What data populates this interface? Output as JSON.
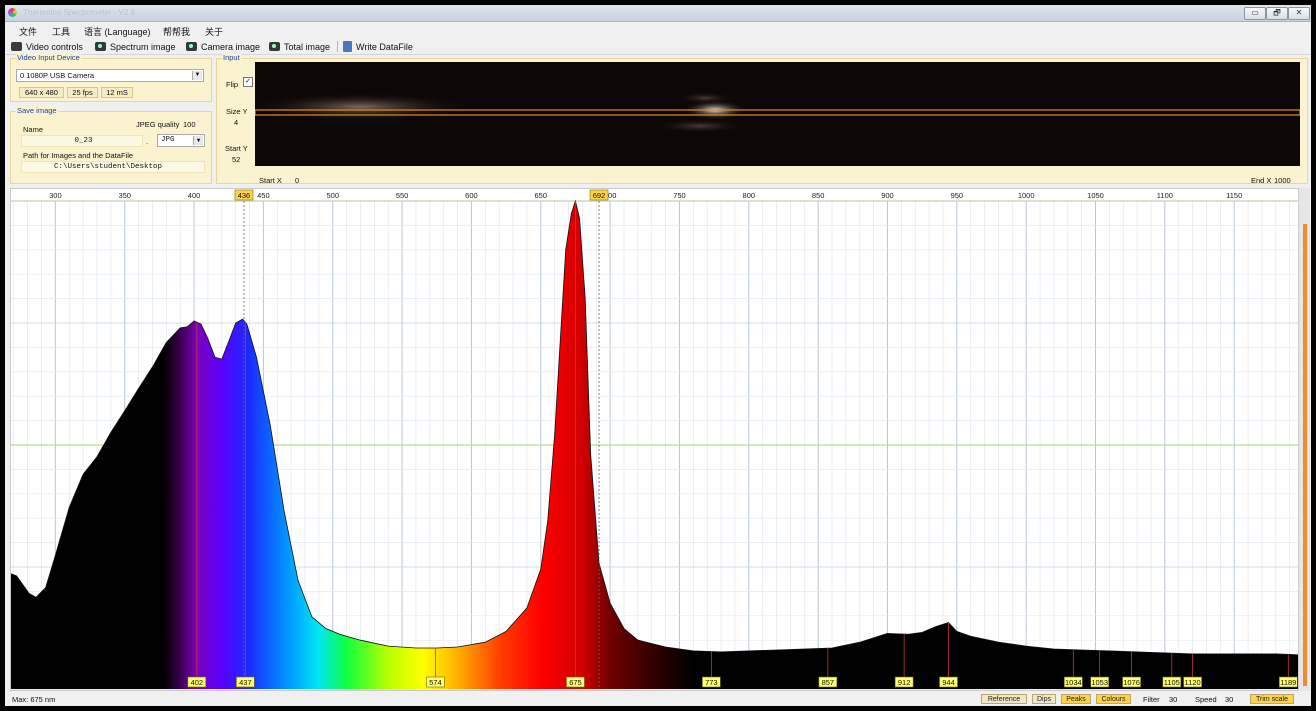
{
  "window": {
    "title": "Theremino Spectrometer - V2.8",
    "buttons": [
      "▭",
      "🗗",
      "✕"
    ]
  },
  "menu": [
    "文件",
    "工具",
    "语言 (Language)",
    "帮帮我",
    "关于"
  ],
  "toolbar": [
    {
      "label": "Video controls",
      "icon": "video-camera-icon"
    },
    {
      "label": "Spectrum image",
      "icon": "photo-camera-icon"
    },
    {
      "label": "Camera image",
      "icon": "photo-camera-icon"
    },
    {
      "label": "Total image",
      "icon": "photo-camera-icon"
    },
    {
      "label": "Write DataFile",
      "icon": "file-icon"
    }
  ],
  "video_input": {
    "title": "Video Input Device",
    "device": "0 1080P USB Camera",
    "resolution": "640 x 480",
    "fps": "25 fps",
    "latency": "12 mS"
  },
  "save_image": {
    "title": "Save image",
    "name_label": "Name",
    "name_value": "0_23",
    "dot": ".",
    "jpeg_quality_label": "JPEG quality",
    "jpeg_quality_value": "100",
    "format": "JPG",
    "path_label": "Path for Images and the DataFile",
    "path_value": "C:\\Users\\student\\Desktop"
  },
  "input": {
    "title": "Input",
    "flip_label": "Flip",
    "flip_checked": true,
    "size_y_label": "Size Y",
    "size_y_value": "4",
    "start_y_label": "Start Y",
    "start_y_value": "52",
    "start_x_label": "Start X",
    "start_x_value": "0",
    "end_x_label": "End X",
    "end_x_value": "1000"
  },
  "status": {
    "max_text": "Max: 675 nm",
    "buttons": [
      {
        "label": "Reference",
        "active": false
      },
      {
        "label": "Dips",
        "active": false
      },
      {
        "label": "Peaks",
        "active": true
      },
      {
        "label": "Colours",
        "active": true
      }
    ],
    "filter_label": "Filter",
    "filter_value": "30",
    "speed_label": "Speed",
    "speed_value": "30",
    "trim_label": "Trim scale"
  },
  "colors": {
    "accent": "#f08a2c",
    "marker_fill": "#ffff70",
    "grid": "#d6e3ee",
    "green_line": "#a6d96a"
  },
  "chart_data": {
    "type": "area",
    "xlim": [
      268,
      1196
    ],
    "ylim": [
      0,
      100
    ],
    "x_ticks": [
      300,
      350,
      400,
      450,
      500,
      550,
      600,
      650,
      700,
      750,
      800,
      850,
      900,
      950,
      1000,
      1050,
      1100,
      1150
    ],
    "cursor_markers": [
      436,
      692
    ],
    "reference_line_y": 50,
    "peaks": [
      402,
      437,
      574,
      675,
      773,
      857,
      912,
      944,
      1034,
      1053,
      1076,
      1105,
      1120,
      1189
    ],
    "series": [
      {
        "x": [
          268,
          272,
          276,
          281,
          286,
          293,
          300,
          310,
          320,
          330,
          340,
          350,
          360,
          370,
          380,
          390,
          395,
          400,
          405,
          410,
          415,
          420,
          425,
          430,
          435,
          438,
          445,
          455,
          465,
          475,
          485,
          495,
          505,
          520,
          540,
          560,
          575,
          590,
          610,
          625,
          640,
          650,
          655,
          660,
          665,
          668,
          672,
          675,
          678,
          682,
          686,
          692,
          700,
          710,
          720,
          740,
          760,
          780,
          800,
          820,
          840,
          860,
          880,
          900,
          915,
          925,
          935,
          944,
          950,
          960,
          980,
          1000,
          1020,
          1040,
          1060,
          1080,
          1100,
          1120,
          1140,
          1160,
          1180,
          1196
        ],
        "y": [
          23.6,
          23.2,
          21.6,
          19.6,
          18.8,
          20.8,
          27.4,
          37.2,
          44.0,
          47.6,
          52.6,
          57.0,
          61.6,
          66.0,
          71.0,
          74.0,
          74.2,
          75.4,
          74.8,
          71.8,
          68.0,
          67.6,
          71.2,
          75.0,
          75.8,
          74.8,
          68.0,
          54.0,
          36.4,
          22.2,
          14.8,
          12.4,
          11.2,
          10.0,
          8.8,
          8.4,
          8.4,
          8.6,
          9.6,
          11.8,
          16.6,
          24.6,
          34.4,
          52.0,
          76.0,
          90.0,
          97.4,
          100,
          96.4,
          80.0,
          48.0,
          25.8,
          17.6,
          12.4,
          10.0,
          8.6,
          7.8,
          7.6,
          7.8,
          8.0,
          8.2,
          8.4,
          9.6,
          11.4,
          11.2,
          11.6,
          12.8,
          13.6,
          11.8,
          10.8,
          9.6,
          8.8,
          8.2,
          8.0,
          7.8,
          7.6,
          7.4,
          7.2,
          7.2,
          7.2,
          7.2,
          7.0
        ]
      }
    ]
  }
}
